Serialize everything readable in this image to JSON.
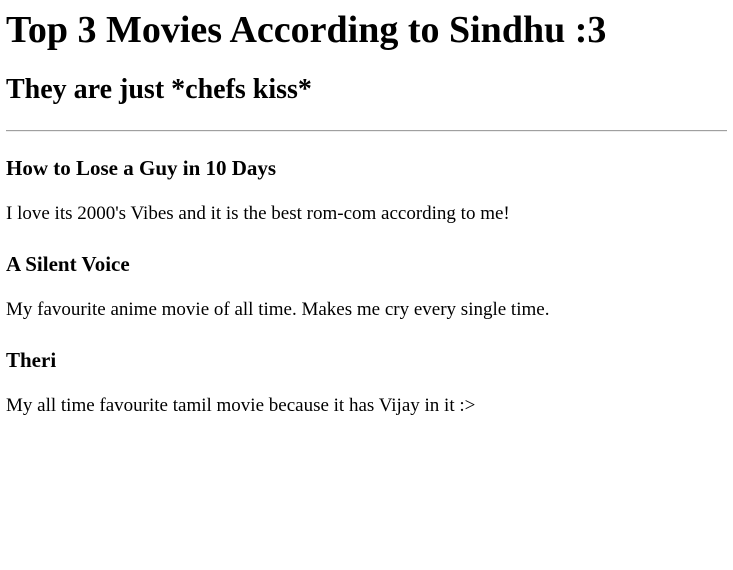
{
  "page": {
    "title": "Top 3 Movies According to Sindhu :3",
    "subtitle": "They are just *chefs kiss*"
  },
  "movies": [
    {
      "title": "How to Lose a Guy in 10 Days",
      "description": "I love its 2000's Vibes and it is the best rom-com according to me!"
    },
    {
      "title": "A Silent Voice",
      "description": "My favourite anime movie of all time. Makes me cry every single time."
    },
    {
      "title": "Theri",
      "description": "My all time favourite tamil movie because it has Vijay in it :>"
    }
  ]
}
